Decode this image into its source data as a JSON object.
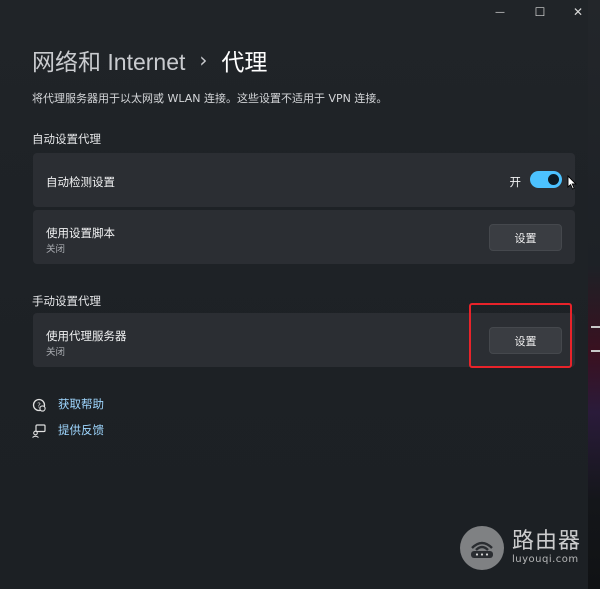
{
  "window": {
    "controls": {
      "minimize_glyph": "—",
      "maximize_glyph": "☐",
      "close_glyph": "✕"
    }
  },
  "breadcrumb": {
    "parent": "网络和 Internet",
    "separator": "›",
    "current": "代理"
  },
  "description": "将代理服务器用于以太网或 WLAN 连接。这些设置不适用于 VPN 连接。",
  "auto_section": {
    "title": "自动设置代理",
    "auto_detect": {
      "label": "自动检测设置",
      "toggle_state_label": "开",
      "toggle_on": true
    },
    "setup_script": {
      "label": "使用设置脚本",
      "status": "关闭",
      "button_label": "设置"
    }
  },
  "manual_section": {
    "title": "手动设置代理",
    "proxy_server": {
      "label": "使用代理服务器",
      "status": "关闭",
      "button_label": "设置"
    }
  },
  "links": {
    "help": "获取帮助",
    "feedback": "提供反馈"
  },
  "watermark": {
    "title": "路由器",
    "domain": "luyouqi.com"
  },
  "colors": {
    "accent": "#4cc2ff",
    "link": "#9fd7ff",
    "highlight_box": "#e8232a",
    "card_bg": "#2b2e33"
  }
}
